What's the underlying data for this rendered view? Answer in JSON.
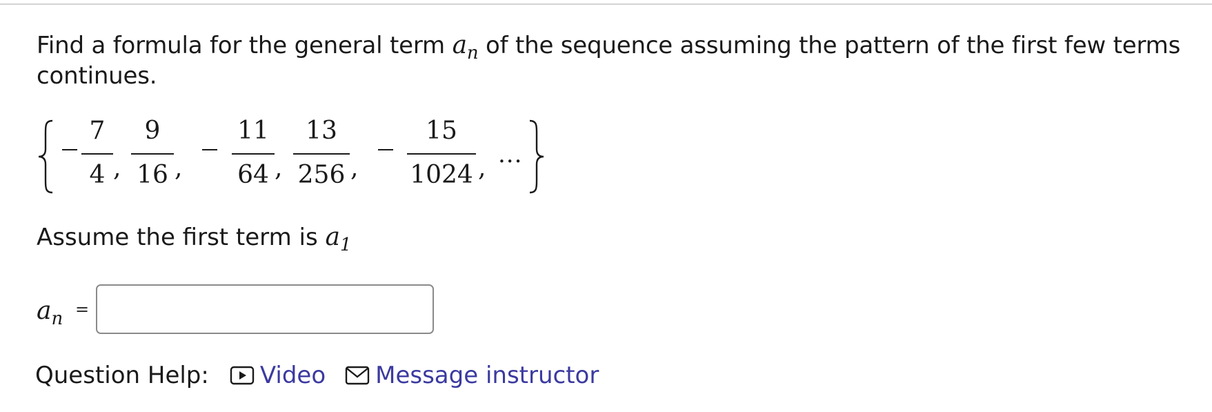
{
  "question": {
    "prefix": "Find a formula for the general term",
    "var_base": "a",
    "var_sub": "n",
    "suffix": "of the sequence assuming the pattern of the first few terms",
    "line2": "continues."
  },
  "sequence": {
    "terms": [
      {
        "sign": "-",
        "num": "7",
        "den": "4"
      },
      {
        "sign": "",
        "num": "9",
        "den": "16"
      },
      {
        "sign": "-",
        "num": "11",
        "den": "64"
      },
      {
        "sign": "",
        "num": "13",
        "den": "256"
      },
      {
        "sign": "-",
        "num": "15",
        "den": "1024"
      }
    ],
    "ellipsis": "..."
  },
  "assume": {
    "text": "Assume the first term is",
    "var_base": "a",
    "var_sub": "1"
  },
  "answer": {
    "var_base": "a",
    "var_sub": "n",
    "equals": "=",
    "value": "",
    "placeholder": ""
  },
  "help": {
    "label": "Question Help:",
    "video_label": "Video",
    "video_icon": "video-play-icon",
    "message_label": "Message instructor",
    "message_icon": "envelope-icon"
  },
  "colors": {
    "link": "#3b3aa0",
    "text": "#1a1a1a",
    "input_border": "#8a8a8a"
  }
}
